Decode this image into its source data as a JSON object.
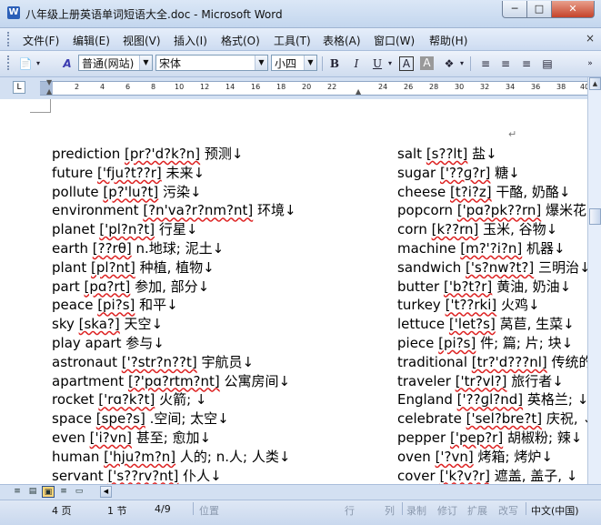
{
  "window": {
    "title": "八年级上册英语单词短语大全.doc - Microsoft Word",
    "app_icon": "W",
    "minimize": "0",
    "maximize": "1",
    "close": "r"
  },
  "menu": {
    "items": [
      "文件(F)",
      "编辑(E)",
      "视图(V)",
      "插入(I)",
      "格式(O)",
      "工具(T)",
      "表格(A)",
      "窗口(W)",
      "帮助(H)"
    ],
    "close_doc": "×"
  },
  "toolbar": {
    "style_value": "普通(网站)",
    "font_value": "宋体",
    "size_value": "小四",
    "bold": "B",
    "italic": "I",
    "underline": "U",
    "char_border": "A",
    "char_shading": "A"
  },
  "ruler": {
    "ticks": [
      "2",
      "4",
      "6",
      "8",
      "10",
      "12",
      "14",
      "16",
      "18",
      "20",
      "22",
      "24",
      "26",
      "28",
      "30",
      "32",
      "34",
      "36",
      "38",
      "40"
    ]
  },
  "document": {
    "left_column": [
      {
        "word": "prediction ",
        "phonetic": "[pr?'d?k?n]",
        "meaning": " 预测↓"
      },
      {
        "word": "future ",
        "phonetic": "['fju?t??r]",
        "meaning": " 未来↓"
      },
      {
        "word": "pollute ",
        "phonetic": "[p?'lu?t]",
        "meaning": " 污染↓"
      },
      {
        "word": "environment ",
        "phonetic": "[?n'va?r?nm?nt]",
        "meaning": " 环境↓"
      },
      {
        "word": "planet ",
        "phonetic": "['pl?n?t]",
        "meaning": " 行星↓"
      },
      {
        "word": "earth ",
        "phonetic": "[??rθ]",
        "meaning": " n.地球; 泥土↓"
      },
      {
        "word": "plant ",
        "phonetic": "[pl?nt]",
        "meaning": " 种植, 植物↓"
      },
      {
        "word": "part ",
        "phonetic": "[pɑ?rt]",
        "meaning": " 参加, 部分↓"
      },
      {
        "word": "peace ",
        "phonetic": "[pi?s]",
        "meaning": " 和平↓"
      },
      {
        "word": "sky ",
        "phonetic": "[ska?]",
        "meaning": " 天空↓"
      },
      {
        "word": "play apart ",
        "phonetic": "",
        "meaning": "参与↓"
      },
      {
        "word": "astronaut ",
        "phonetic": "['?str?n??t]",
        "meaning": " 宇航员↓"
      },
      {
        "word": "apartment ",
        "phonetic": "[?'pɑ?rtm?nt]",
        "meaning": " 公寓房间↓"
      },
      {
        "word": "rocket ",
        "phonetic": "['rɑ?k?t]",
        "meaning": " 火箭; ↓"
      },
      {
        "word": "space ",
        "phonetic": "[spe?s]",
        "meaning": " .空间; 太空↓"
      },
      {
        "word": "even ",
        "phonetic": "['i?vn]",
        "meaning": " 甚至; 愈加↓"
      },
      {
        "word": "human ",
        "phonetic": "['hju?m?n]",
        "meaning": " 人的; n.人; 人类↓"
      },
      {
        "word": "servant ",
        "phonetic": "['s??rv?nt]",
        "meaning": " 仆人↓"
      }
    ],
    "right_column": [
      {
        "word": "salt ",
        "phonetic": "[s??lt]",
        "meaning": " 盐↓"
      },
      {
        "word": "sugar ",
        "phonetic": "['??ɡ?r]",
        "meaning": " 糖↓"
      },
      {
        "word": "cheese ",
        "phonetic": "[t?i?z]",
        "meaning": " 干酪, 奶酪↓"
      },
      {
        "word": "popcorn ",
        "phonetic": "['pɑ?pk??rn]",
        "meaning": " 爆米花↓"
      },
      {
        "word": "corn ",
        "phonetic": "[k??rn]",
        "meaning": " 玉米, 谷物↓"
      },
      {
        "word": "machine ",
        "phonetic": "[m?'?i?n]",
        "meaning": " 机器↓"
      },
      {
        "word": "sandwich ",
        "phonetic": "['s?nw?t?]",
        "meaning": " 三明治↓"
      },
      {
        "word": "butter ",
        "phonetic": "['b?t?r]",
        "meaning": " 黄油, 奶油↓"
      },
      {
        "word": "turkey ",
        "phonetic": "['t??rki]",
        "meaning": " 火鸡↓"
      },
      {
        "word": "lettuce ",
        "phonetic": "['let?s]",
        "meaning": " 莴苣, 生菜↓"
      },
      {
        "word": "piece ",
        "phonetic": "[pi?s]",
        "meaning": " 件; 篇; 片; 块↓"
      },
      {
        "word": "traditional ",
        "phonetic": "[tr?'d???nl]",
        "meaning": " 传统的↓"
      },
      {
        "word": "traveler ",
        "phonetic": "['tr?vl?]",
        "meaning": " 旅行者↓"
      },
      {
        "word": "England ",
        "phonetic": "['??ɡl?nd]",
        "meaning": " 英格兰; ↓"
      },
      {
        "word": "celebrate ",
        "phonetic": "['sel?bre?t]",
        "meaning": " 庆祝, ↓"
      },
      {
        "word": "pepper ",
        "phonetic": "['pep?r]",
        "meaning": " 胡椒粉; 辣↓"
      },
      {
        "word": "oven ",
        "phonetic": "['?vn]",
        "meaning": " 烤箱; 烤炉↓"
      },
      {
        "word": "cover ",
        "phonetic": "['k?v?r]",
        "meaning": " 遮盖, 盖子, ↓"
      }
    ],
    "para_mark": "↵"
  },
  "statusbar": {
    "page": "4 页",
    "section": "1 节",
    "page_of": "4/9",
    "position": "位置",
    "line": "行",
    "column": "列",
    "rec": "录制",
    "trk": "修订",
    "ext": "扩展",
    "ovr": "改写",
    "language": "中文(中国)"
  },
  "colors": {
    "chrome": "#c9d9ee",
    "accent": "#2b5fb8",
    "spell_underline": "#dd2222"
  }
}
